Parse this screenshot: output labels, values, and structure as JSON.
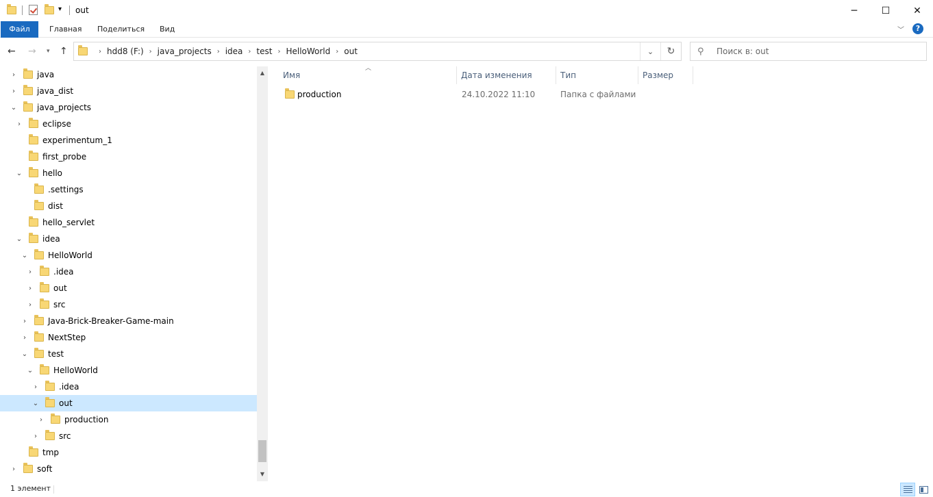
{
  "window": {
    "title": "out"
  },
  "ribbon": {
    "tabs": [
      {
        "label": "Файл"
      },
      {
        "label": "Главная"
      },
      {
        "label": "Поделиться"
      },
      {
        "label": "Вид"
      }
    ],
    "help_label": "?"
  },
  "address": {
    "crumbs": [
      "hdd8 (F:)",
      "java_projects",
      "idea",
      "test",
      "HelloWorld",
      "out"
    ]
  },
  "search": {
    "placeholder": "Поиск в: out"
  },
  "tree": {
    "items": [
      {
        "label": "java"
      },
      {
        "label": "java_dist"
      },
      {
        "label": "java_projects"
      },
      {
        "label": "eclipse"
      },
      {
        "label": "experimentum_1"
      },
      {
        "label": "first_probe"
      },
      {
        "label": "hello"
      },
      {
        "label": ".settings"
      },
      {
        "label": "dist"
      },
      {
        "label": "hello_servlet"
      },
      {
        "label": "idea"
      },
      {
        "label": "HelloWorld"
      },
      {
        "label": ".idea"
      },
      {
        "label": "out"
      },
      {
        "label": "src"
      },
      {
        "label": "Java-Brick-Breaker-Game-main"
      },
      {
        "label": "NextStep"
      },
      {
        "label": "test"
      },
      {
        "label": "HelloWorld"
      },
      {
        "label": ".idea"
      },
      {
        "label": "out"
      },
      {
        "label": "production"
      },
      {
        "label": "src"
      },
      {
        "label": "tmp"
      },
      {
        "label": "soft"
      }
    ]
  },
  "columns": {
    "name": "Имя",
    "date": "Дата изменения",
    "type": "Тип",
    "size": "Размер"
  },
  "files": [
    {
      "name": "production",
      "date": "24.10.2022 11:10",
      "type": "Папка с файлами",
      "size": ""
    }
  ],
  "status": {
    "count": "1 элемент"
  },
  "colors": {
    "accent": "#1a6ac0",
    "selection": "#cce8ff",
    "folder": "#f8d775"
  }
}
